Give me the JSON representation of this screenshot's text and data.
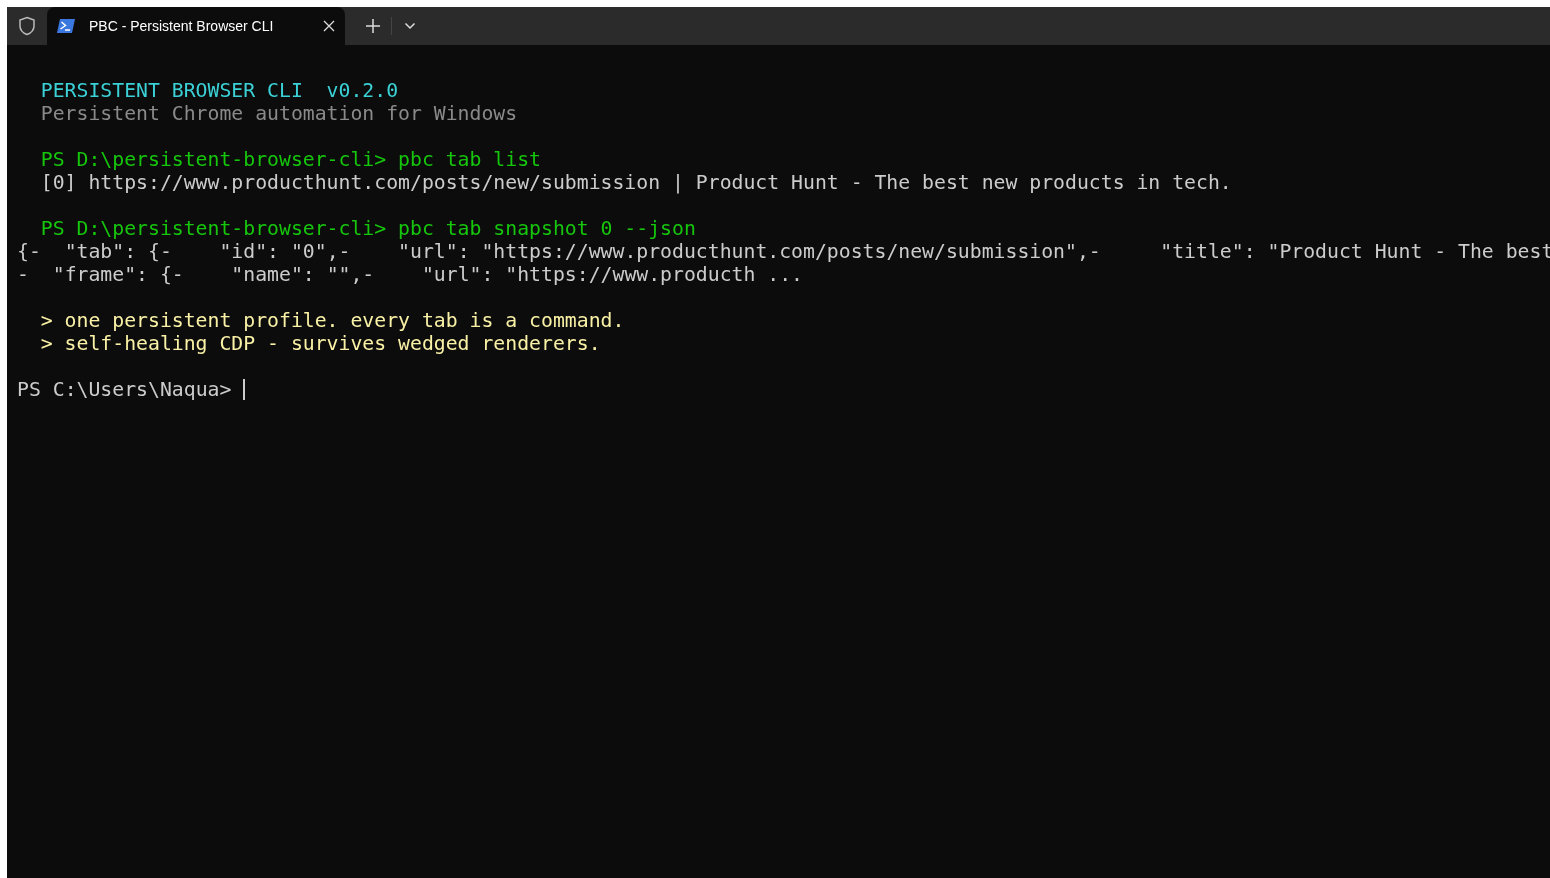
{
  "window": {
    "tabs": [
      {
        "title": "PBC - Persistent Browser CLI",
        "selected": true
      }
    ]
  },
  "terminal": {
    "lines": [
      {
        "kind": "blank"
      },
      {
        "kind": "text",
        "indented": true,
        "text": "PERSISTENT BROWSER CLI  v0.2.0",
        "color": "#3bd1d6"
      },
      {
        "kind": "text",
        "indented": true,
        "text": "Persistent Chrome automation for Windows",
        "color": "#8a8a8a"
      },
      {
        "kind": "blank"
      },
      {
        "kind": "text",
        "indented": true,
        "text": "PS D:\\persistent-browser-cli> pbc tab list",
        "color": "#16c60c"
      },
      {
        "kind": "text",
        "indented": true,
        "text": "[0] https://www.producthunt.com/posts/new/submission | Product Hunt - The best new products in tech.",
        "color": "#cccccc"
      },
      {
        "kind": "blank"
      },
      {
        "kind": "text",
        "indented": true,
        "text": "PS D:\\persistent-browser-cli> pbc tab snapshot 0 --json",
        "color": "#16c60c"
      },
      {
        "kind": "text",
        "indented": false,
        "text": "{-  \"tab\": {-    \"id\": \"0\",-    \"url\": \"https://www.producthunt.com/posts/new/submission\",-     \"title\": \"Product Hunt - The best",
        "color": "#cccccc"
      },
      {
        "kind": "text",
        "indented": false,
        "text": "-  \"frame\": {-    \"name\": \"\",-    \"url\": \"https://www.producth ...",
        "color": "#cccccc"
      },
      {
        "kind": "blank"
      },
      {
        "kind": "text",
        "indented": true,
        "text": "> one persistent profile. every tab is a command.",
        "color": "#f9f1a5"
      },
      {
        "kind": "text",
        "indented": true,
        "text": "> self-healing CDP - survives wedged renderers.",
        "color": "#f9f1a5"
      },
      {
        "kind": "blank"
      },
      {
        "kind": "prompt",
        "indented": false,
        "text": "PS C:\\Users\\Naqua> ",
        "color": "#cccccc"
      }
    ]
  }
}
